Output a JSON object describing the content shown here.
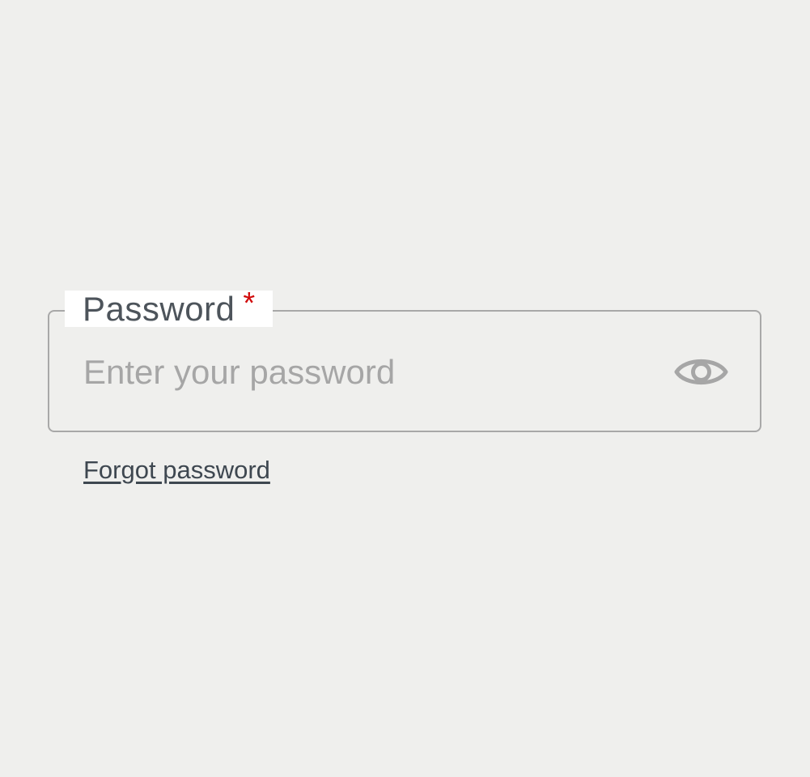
{
  "password_field": {
    "label": "Password",
    "required_marker": "*",
    "placeholder": "Enter your password",
    "visibility_toggle_icon": "eye-icon"
  },
  "links": {
    "forgot_password": "Forgot password"
  },
  "colors": {
    "background": "#efefed",
    "label_text": "#4d545b",
    "required_star": "#d10b0b",
    "placeholder": "#a6a6a6",
    "border": "#a8a8a8",
    "icon": "#a6a6a6",
    "link": "#3e4750"
  }
}
